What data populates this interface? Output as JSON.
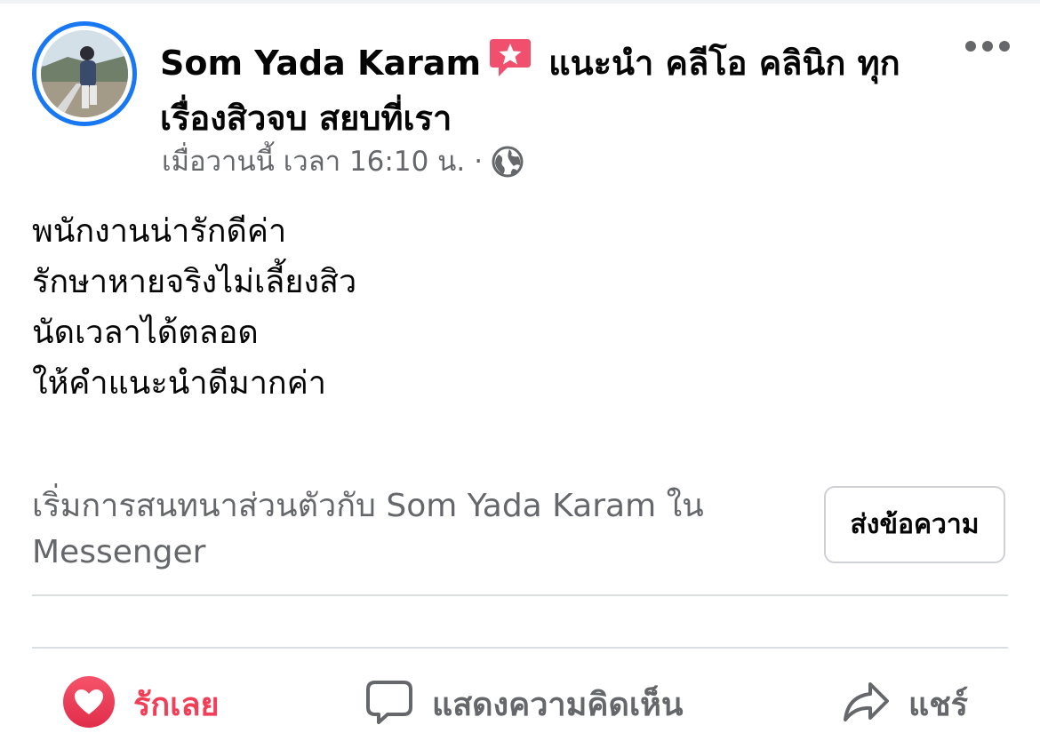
{
  "post": {
    "author": "Som Yada Karam",
    "action_text": "แนะนำ คลีโอ คลินิก ทุกเรื่องสิวจบ สยบที่เรา",
    "timestamp": "เมื่อวานนี้ เวลา 16:10 น.",
    "separator": "·",
    "privacy_icon": "globe-icon",
    "badge_icon": "recommendation-star-icon",
    "body_lines": [
      "พนักงานน่ารักดีค่า",
      "รักษาหายจริงไม่เลี้ยงสิว",
      "นัดเวลาได้ตลอด",
      "ให้คำแนะนำดีมากค่า"
    ]
  },
  "messenger": {
    "prompt": "เริ่มการสนทนาส่วนตัวกับ Som Yada Karam ใน Messenger",
    "button_label": "ส่งข้อความ"
  },
  "actions": {
    "like": {
      "label": "รักเลย",
      "icon": "heart-icon",
      "color": "#f33e58"
    },
    "comment": {
      "label": "แสดงความคิดเห็น",
      "icon": "comment-icon"
    },
    "share": {
      "label": "แชร์",
      "icon": "share-icon"
    }
  },
  "colors": {
    "accent_blue": "#1877f2",
    "secondary_text": "#65676b",
    "badge_pink": "#f0506e"
  }
}
